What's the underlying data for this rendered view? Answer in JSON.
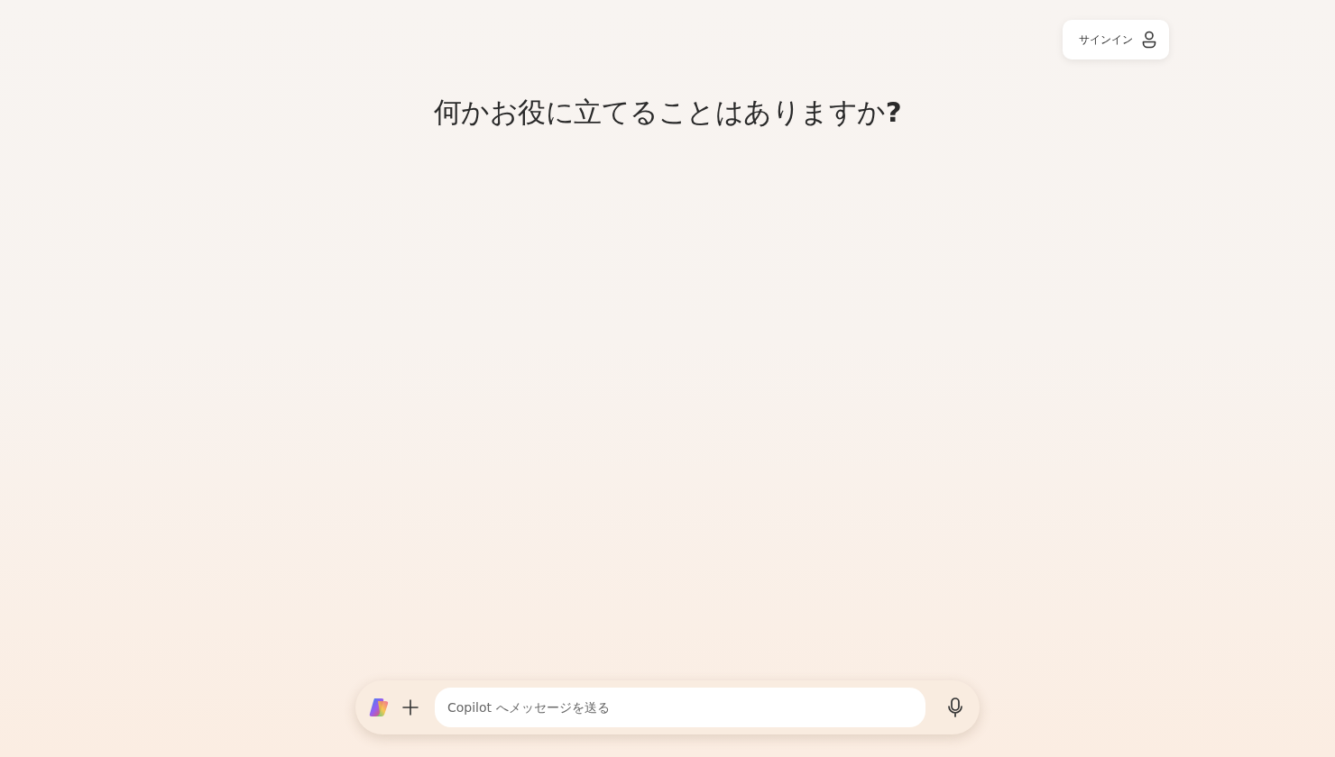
{
  "header": {
    "sign_in_button": "サインイン"
  },
  "heading": "何かお役に立てることはありますか**?**",
  "composer": {
    "placeholder": "Copilot へメッセージを送る"
  }
}
